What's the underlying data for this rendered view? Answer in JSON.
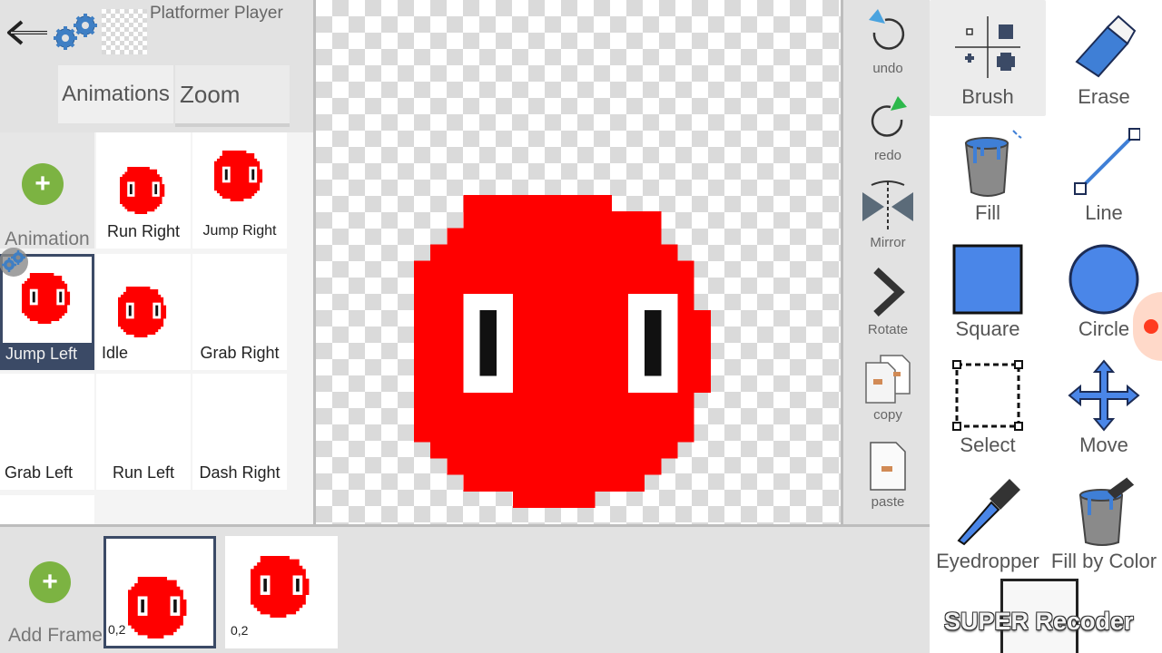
{
  "header": {
    "sprite_name": "Platformer Player",
    "back_icon": "back-arrow-icon",
    "settings_icon": "gears-icon"
  },
  "tabs": [
    {
      "label": "Animations",
      "active": true
    },
    {
      "label": "Zoom",
      "active": false
    }
  ],
  "animations": {
    "add_label": "Animation",
    "items": [
      {
        "label": "Run Right"
      },
      {
        "label": "Jump Right"
      },
      {
        "label": "Jump Left",
        "selected": true
      },
      {
        "label": "Idle"
      },
      {
        "label": "Grab Right"
      },
      {
        "label": "Grab Left"
      },
      {
        "label": "Run Left"
      },
      {
        "label": "Dash Right"
      }
    ]
  },
  "actions": [
    {
      "label": "undo",
      "icon": "undo-icon"
    },
    {
      "label": "redo",
      "icon": "redo-icon"
    },
    {
      "label": "Mirror",
      "icon": "mirror-icon"
    },
    {
      "label": "Rotate",
      "icon": "rotate-icon"
    },
    {
      "label": "copy",
      "icon": "copy-icon"
    },
    {
      "label": "paste",
      "icon": "paste-icon"
    }
  ],
  "tools": [
    {
      "label": "Brush",
      "icon": "brush-size-icon",
      "active": true
    },
    {
      "label": "Erase",
      "icon": "eraser-icon"
    },
    {
      "label": "Fill",
      "icon": "paint-bucket-icon"
    },
    {
      "label": "Line",
      "icon": "line-icon"
    },
    {
      "label": "Square",
      "icon": "square-icon"
    },
    {
      "label": "Circle",
      "icon": "circle-icon"
    },
    {
      "label": "Select",
      "icon": "select-marquee-icon"
    },
    {
      "label": "Move",
      "icon": "move-arrows-icon"
    },
    {
      "label": "Eyedropper",
      "icon": "eyedropper-icon"
    },
    {
      "label": "Fill by Color",
      "icon": "fill-by-color-icon"
    }
  ],
  "frames": {
    "add_label": "Add Frame",
    "items": [
      {
        "duration": "0,2",
        "selected": true
      },
      {
        "duration": "0,2",
        "selected": false
      }
    ]
  },
  "watermark": "SUPER Recoder",
  "colors": {
    "sprite_red": "#ff0000",
    "tool_blue": "#4a86e8",
    "selection_navy": "#3b4a66",
    "add_green": "#7cb342"
  }
}
